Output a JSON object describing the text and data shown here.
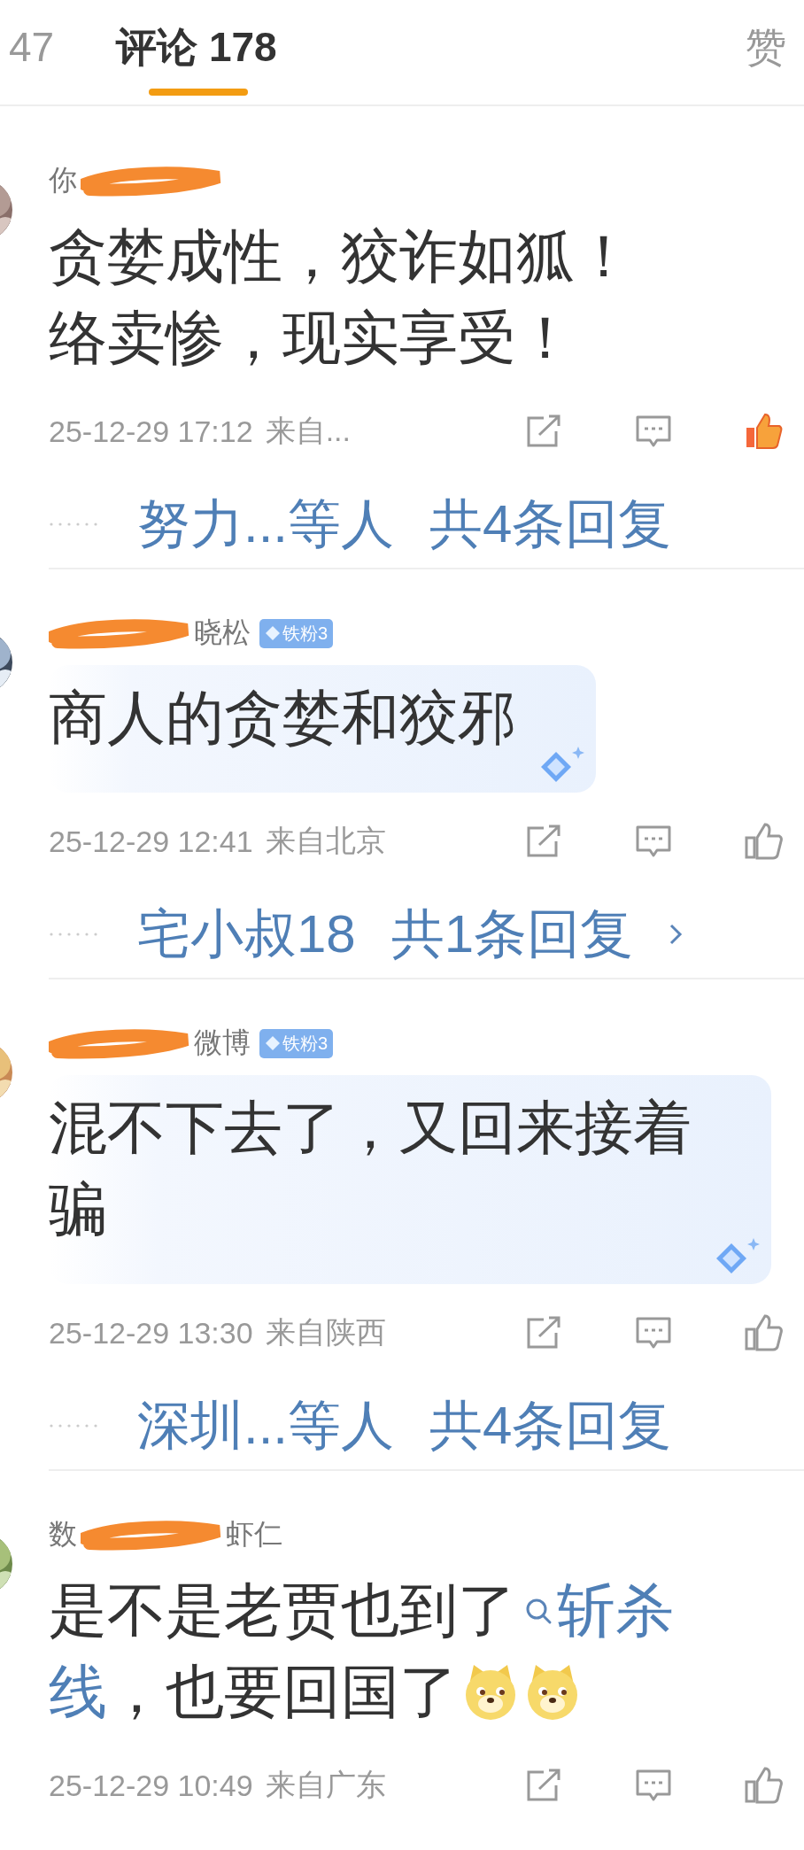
{
  "tabs": [
    {
      "label": "47",
      "selected": false
    },
    {
      "label": "评论 178",
      "selected": true
    },
    {
      "label": "赞",
      "selected": false
    }
  ],
  "comments": [
    {
      "name_parts": [
        {
          "kind": "text",
          "text": "你"
        },
        {
          "kind": "redaction"
        }
      ],
      "bubble": false,
      "lines": [
        [
          {
            "kind": "text",
            "text": "贪婪成性，狡诈如狐！"
          }
        ],
        [
          {
            "kind": "text",
            "text": "络卖惨，现实享受！"
          }
        ]
      ],
      "time": "25-12-29 17:12",
      "location": "来自...",
      "liked": true,
      "reply": {
        "names": "努力...等人",
        "count": "共4条回复",
        "chevron": false
      }
    },
    {
      "name_parts": [
        {
          "kind": "redaction"
        },
        {
          "kind": "text",
          "text": "晓松"
        }
      ],
      "badge": "铁粉3",
      "bubble": true,
      "lines": [
        [
          {
            "kind": "text",
            "text": "商人的贪婪和狡邪"
          }
        ]
      ],
      "time": "25-12-29 12:41",
      "location": "来自北京",
      "liked": false,
      "reply": {
        "names": "宅小叔18",
        "count": "共1条回复",
        "chevron": true
      }
    },
    {
      "name_parts": [
        {
          "kind": "redaction"
        },
        {
          "kind": "text",
          "text": "微博"
        }
      ],
      "badge": "铁粉3",
      "bubble": true,
      "lines": [
        [
          {
            "kind": "text",
            "text": "混不下去了，又回来接着"
          }
        ],
        [
          {
            "kind": "text",
            "text": "骗"
          }
        ]
      ],
      "time": "25-12-29 13:30",
      "location": "来自陕西",
      "liked": false,
      "reply": {
        "names": "深圳...等人",
        "count": "共4条回复",
        "chevron": false
      }
    },
    {
      "name_parts": [
        {
          "kind": "text",
          "text": "数"
        },
        {
          "kind": "redaction"
        },
        {
          "kind": "text",
          "text": "虾仁"
        }
      ],
      "bubble": false,
      "lines": [
        [
          {
            "kind": "text",
            "text": "是不是老贾也到了"
          },
          {
            "kind": "topic",
            "text": "斩杀"
          }
        ],
        [
          {
            "kind": "topic",
            "text": "线"
          },
          {
            "kind": "text",
            "text": "，也要回国了"
          },
          {
            "kind": "emoji"
          },
          {
            "kind": "emoji"
          }
        ]
      ],
      "time": "25-12-29 10:49",
      "location": "来自广东",
      "liked": false
    }
  ]
}
